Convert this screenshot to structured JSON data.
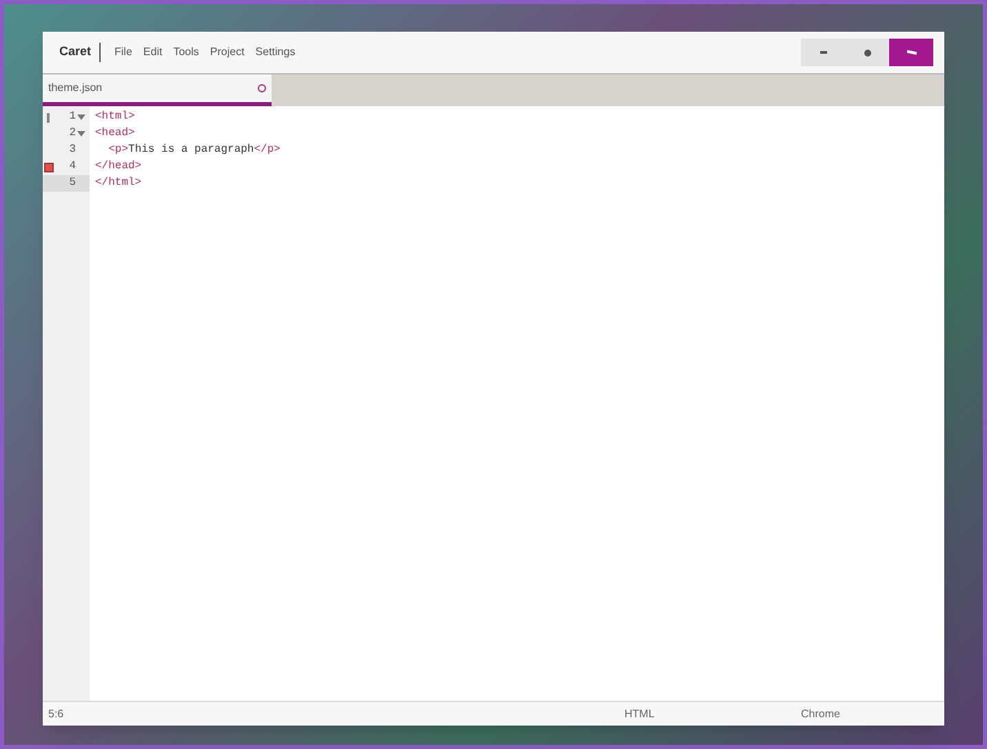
{
  "window": {
    "app_name": "Caret",
    "menu": [
      "File",
      "Edit",
      "Tools",
      "Project",
      "Settings"
    ]
  },
  "tabs": [
    {
      "label": "theme.json",
      "selected": true
    }
  ],
  "editor": {
    "lines": [
      {
        "number": "1",
        "fold": true,
        "error": false,
        "active": false,
        "marker": true,
        "tokens": [
          {
            "kind": "tag",
            "text": "<html>"
          }
        ]
      },
      {
        "number": "2",
        "fold": true,
        "error": false,
        "active": false,
        "marker": false,
        "tokens": [
          {
            "kind": "tag",
            "text": "<head>"
          }
        ]
      },
      {
        "number": "3",
        "fold": false,
        "error": false,
        "active": false,
        "marker": false,
        "tokens": [
          {
            "kind": "tag",
            "text": "  <p>"
          },
          {
            "kind": "text",
            "text": "This is a paragraph"
          },
          {
            "kind": "tag",
            "text": "</p>"
          }
        ]
      },
      {
        "number": "4",
        "fold": false,
        "error": true,
        "active": false,
        "marker": false,
        "tokens": [
          {
            "kind": "tag",
            "text": "</head>"
          }
        ]
      },
      {
        "number": "5",
        "fold": false,
        "error": false,
        "active": true,
        "marker": false,
        "tokens": [
          {
            "kind": "tag",
            "text": "</html>"
          }
        ]
      }
    ]
  },
  "status_bar": {
    "position": "5:6",
    "mode": "HTML",
    "theme": "Chrome"
  }
}
